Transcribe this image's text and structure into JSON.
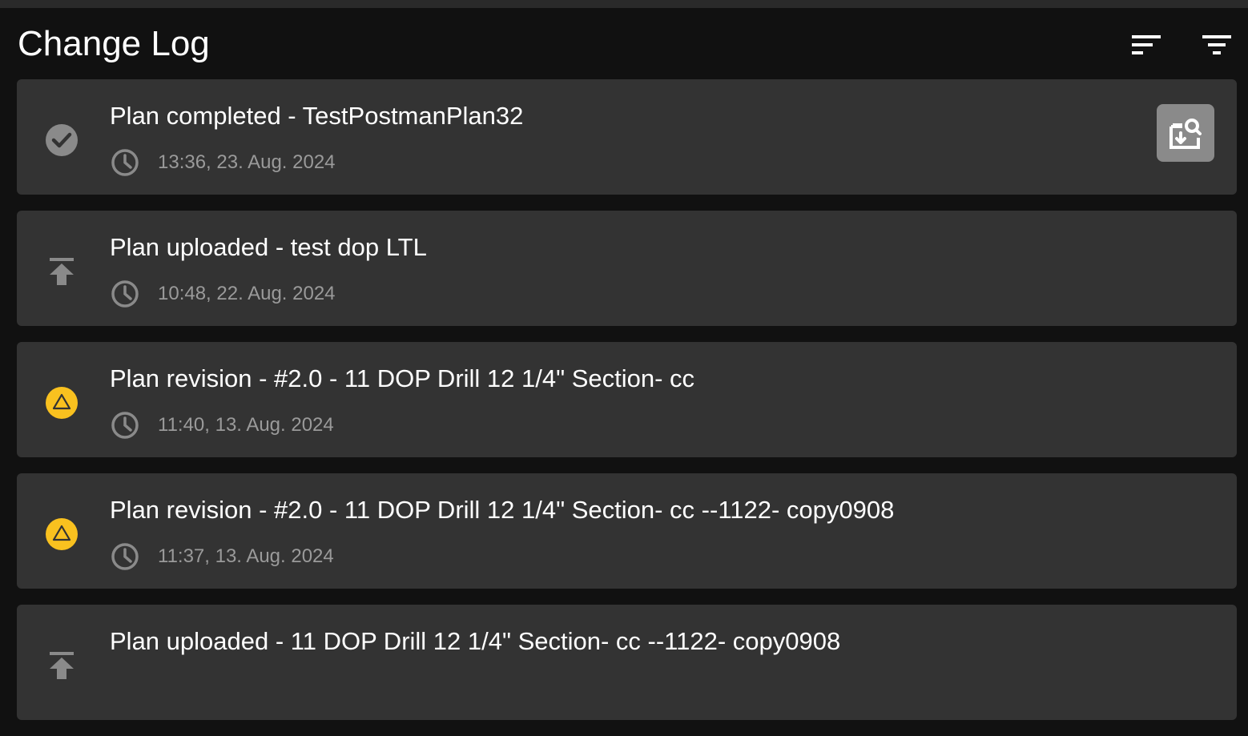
{
  "header": {
    "title": "Change Log",
    "sort_icon": "sort-icon",
    "filter_icon": "filter-icon"
  },
  "colors": {
    "background": "#111111",
    "card": "#333333",
    "warning": "#f9c11f",
    "muted": "#9a9a9a"
  },
  "entries": [
    {
      "title": "Plan completed - TestPostmanPlan32",
      "time": "13:36, 23. Aug. 2024",
      "status_icon": "check-circle-icon",
      "action_icon": "report-download-icon"
    },
    {
      "title": "Plan uploaded - test dop LTL",
      "time": "10:48, 22. Aug. 2024",
      "status_icon": "upload-icon"
    },
    {
      "title": "Plan revision - #2.0 - 11 DOP Drill 12 1/4\" Section- cc",
      "time": "11:40, 13. Aug. 2024",
      "status_icon": "warning-icon"
    },
    {
      "title": "Plan revision - #2.0 - 11 DOP Drill 12 1/4\" Section- cc --1122- copy0908",
      "time": "11:37, 13. Aug. 2024",
      "status_icon": "warning-icon"
    },
    {
      "title": "Plan uploaded - 11 DOP Drill 12 1/4\" Section- cc --1122- copy0908",
      "time": "",
      "status_icon": "upload-icon"
    }
  ]
}
